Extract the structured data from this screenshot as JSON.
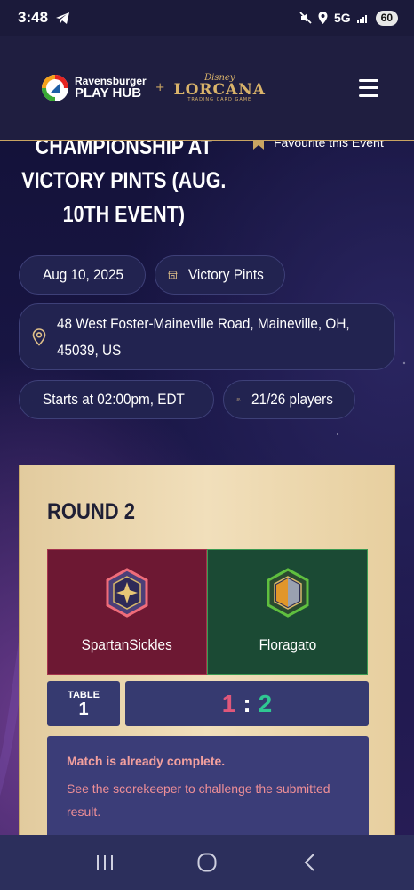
{
  "status_bar": {
    "time": "3:48",
    "network": "5G",
    "battery": "60"
  },
  "header": {
    "brand_top": "Ravensburger",
    "brand_bottom": "PLAY HUB",
    "plus": "+",
    "lorcana_disney": "Disney",
    "lorcana_main": "LORCANA",
    "lorcana_sub": "TRADING CARD GAME"
  },
  "event": {
    "title_line1": "CHAMPIONSHIP AT",
    "title_line2": "VICTORY PINTS (AUG.",
    "title_line3": "10TH EVENT)",
    "favourite_label": "Favourite this Event",
    "date": "Aug 10, 2025",
    "venue": "Victory Pints",
    "address_line1": "48 West Foster-Maineville Road, Maineville, OH,",
    "address_line2": "45039, US",
    "start_time": "Starts at 02:00pm, EDT",
    "players": "21/26 players"
  },
  "match": {
    "round": "ROUND 2",
    "player1": "SpartanSickles",
    "player2": "Floragato",
    "table_label": "TABLE",
    "table_number": "1",
    "score1": "1",
    "score_sep": ":",
    "score2": "2",
    "notice_head": "Match is already complete.",
    "notice_body_line1": "See the scorekeeper to challenge the submitted",
    "notice_body_line2": "result."
  },
  "colors": {
    "accent_gold": "#c9a462",
    "player1_bg": "#6d1833",
    "player2_bg": "#1b4a34",
    "score1": "#e0577a",
    "score2": "#2fc792"
  },
  "icons": {
    "status": [
      "telegram-icon",
      "mute-icon",
      "location-icon",
      "signal-icon"
    ],
    "chips": [
      "calendar-icon",
      "store-icon",
      "map-pin-icon",
      "clock-icon",
      "users-icon"
    ],
    "nav": [
      "recents-icon",
      "home-icon",
      "back-icon"
    ]
  }
}
